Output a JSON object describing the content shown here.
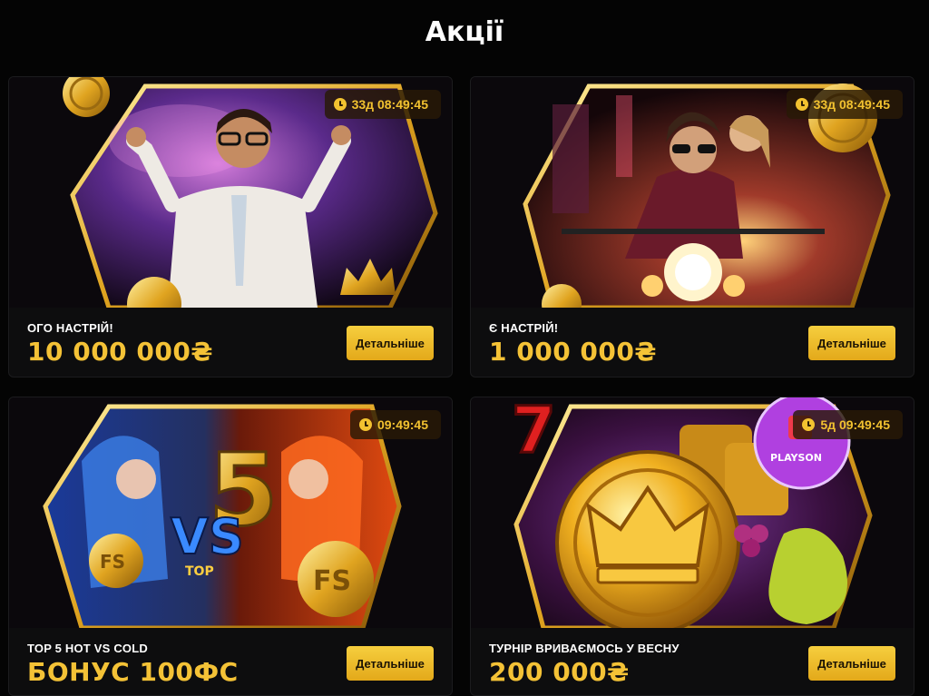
{
  "page": {
    "title": "Акції"
  },
  "promos": [
    {
      "subtitle": "ОГО НАСТРІЙ!",
      "amount": "10 000 000₴",
      "timer": "33д 08:49:45",
      "button_label": "Детальніше"
    },
    {
      "subtitle": "Є НАСТРІЙ!",
      "amount": "1 000 000₴",
      "timer": "33д 08:49:45",
      "button_label": "Детальніше"
    },
    {
      "subtitle": "TOP 5 HOT VS COLD",
      "amount": "БОНУС 100ФС",
      "timer": "09:49:45",
      "button_label": "Детальніше",
      "art": {
        "big_text": "5",
        "vs_text": "VS",
        "top_text": "TOP",
        "coin_text": "FS"
      }
    },
    {
      "subtitle": "ТУРНІР ВРИВАЄМОСЬ У ВЕСНУ",
      "amount": "200 000₴",
      "timer": "5д 09:49:45",
      "button_label": "Детальніше",
      "art": {
        "provider_logo": "PLAYSON"
      }
    }
  ],
  "colors": {
    "accent": "#f4c236",
    "background": "#040404",
    "card": "#0d0d0e",
    "button": "#e9b523"
  }
}
